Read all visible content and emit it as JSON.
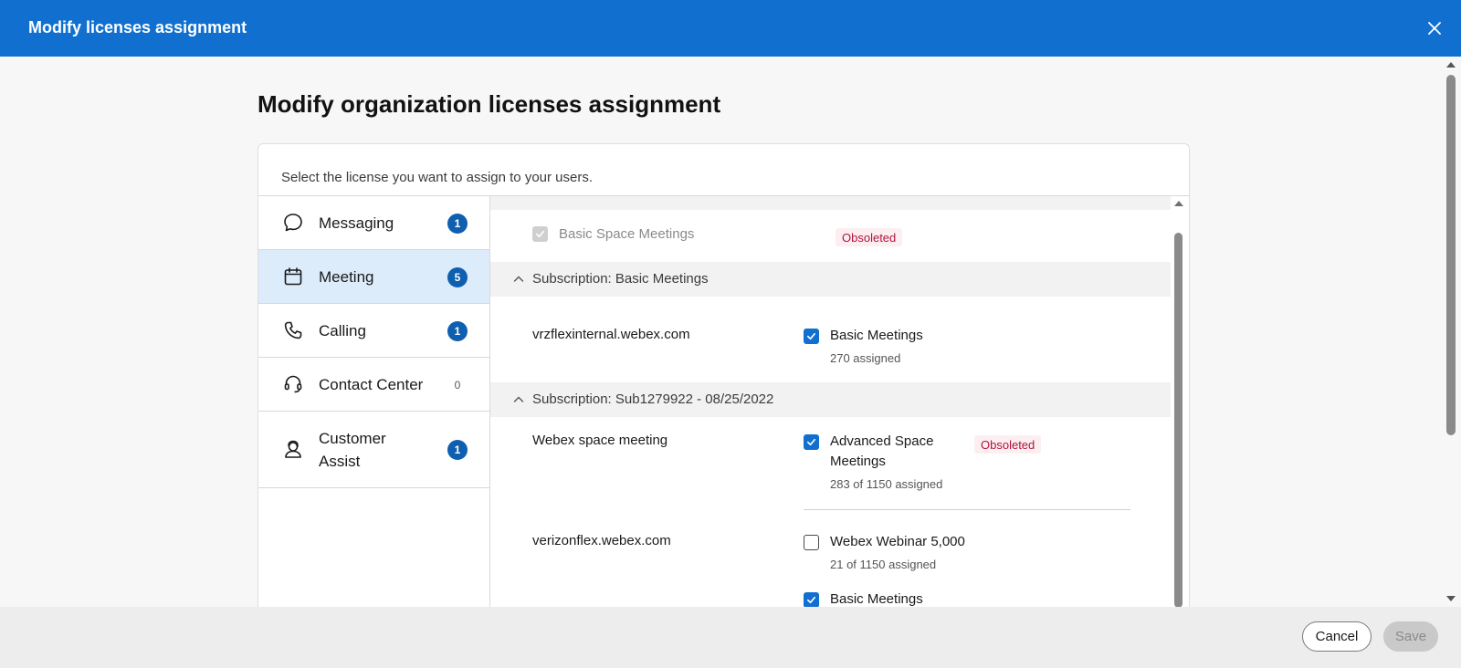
{
  "modal": {
    "title": "Modify licenses assignment",
    "close_icon": "close-icon"
  },
  "page": {
    "title": "Modify organization licenses assignment",
    "hint": "Select the license you want to assign to your users."
  },
  "sidebar": {
    "items": [
      {
        "label": "Messaging",
        "count": "1",
        "icon": "chat-bubble-icon"
      },
      {
        "label": "Meeting",
        "count": "5",
        "icon": "calendar-icon",
        "active": true
      },
      {
        "label": "Calling",
        "count": "1",
        "icon": "phone-icon"
      },
      {
        "label": "Contact Center",
        "count": "0",
        "icon": "headset-icon"
      },
      {
        "label": "Customer Assist",
        "count": "1",
        "icon": "customer-assist-icon"
      }
    ]
  },
  "content": {
    "top_row": {
      "license": "Basic Space Meetings",
      "badge": "Obsoleted",
      "checked": true,
      "disabled": true
    },
    "subscriptions": [
      {
        "title": "Subscription: Basic Meetings",
        "rows": [
          {
            "site": "vrzflexinternal.webex.com",
            "license": "Basic Meetings",
            "assigned": "270 assigned",
            "checked": true
          }
        ]
      },
      {
        "title": "Subscription: Sub1279922 - 08/25/2022",
        "rows": [
          {
            "site": "Webex space meeting",
            "license": "Advanced Space Meetings",
            "license_line1": "Advanced Space",
            "license_line2": "Meetings",
            "assigned": "283 of 1150 assigned",
            "badge": "Obsoleted",
            "checked": true
          },
          {
            "site": "verizonflex.webex.com",
            "license": "Webex Webinar 5,000",
            "assigned": "21 of 1150 assigned",
            "checked": false
          },
          {
            "site": "",
            "license": "Basic Meetings",
            "checked": true
          }
        ]
      }
    ]
  },
  "footer": {
    "cancel_label": "Cancel",
    "save_label": "Save",
    "save_disabled": true
  },
  "colors": {
    "header": "#1170cf",
    "active_nav": "#dcecfb",
    "badge": "#0f5fb0",
    "obsoleted_bg": "#fdeef1",
    "obsoleted_text": "#b0153d"
  }
}
